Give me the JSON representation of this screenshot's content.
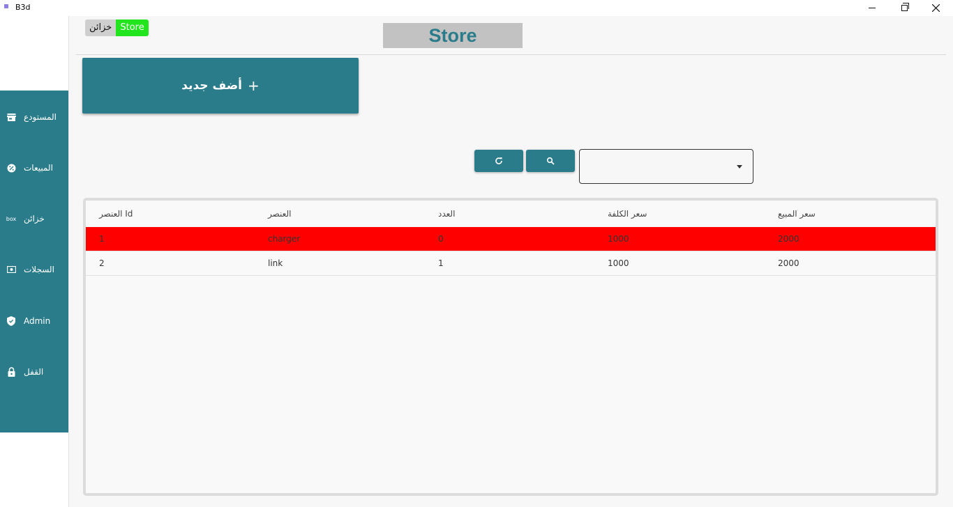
{
  "window": {
    "title": "B3d"
  },
  "sidebar": {
    "items": [
      {
        "label": "المستودع",
        "icon": "store-icon"
      },
      {
        "label": "المبيعات",
        "icon": "badge-icon"
      },
      {
        "label": "خزائن",
        "icon": "box-icon",
        "icon_text": "box"
      },
      {
        "label": "السجلات",
        "icon": "money-icon"
      },
      {
        "label": "Admin",
        "icon": "shield-icon"
      },
      {
        "label": "القفل",
        "icon": "lock-icon"
      }
    ]
  },
  "header": {
    "tag_ar": "خزائن",
    "tag_en": "Store",
    "title": "Store"
  },
  "actions": {
    "add_plus": "+",
    "add_label": "أضف جديد"
  },
  "table": {
    "columns": [
      "العنصر Id",
      "العنصر",
      "العدد",
      "سعر الكلفة",
      "سعر المبيع"
    ],
    "rows": [
      {
        "id": "1",
        "item": "charger",
        "count": "0",
        "cost": "1000",
        "price": "2000",
        "highlight": true
      },
      {
        "id": "2",
        "item": "link",
        "count": "1",
        "cost": "1000",
        "price": "2000",
        "highlight": false
      }
    ]
  },
  "colors": {
    "primary": "#2b7c8b",
    "tag_green": "#22e51d",
    "out_of_stock_row": "#ff0000",
    "title_box": "#c2c2c2"
  }
}
